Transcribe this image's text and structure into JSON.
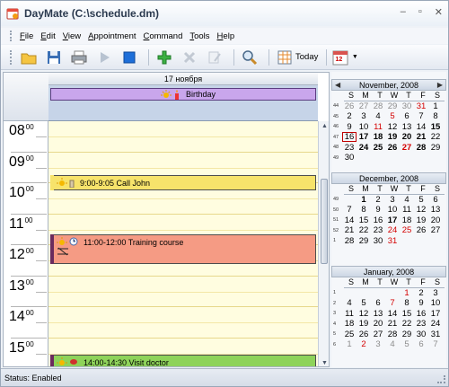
{
  "window": {
    "title": "DayMate (C:\\schedule.dm)"
  },
  "menu": {
    "items": [
      {
        "label": "File",
        "key": "F",
        "rest": "ile"
      },
      {
        "label": "Edit",
        "key": "E",
        "rest": "dit"
      },
      {
        "label": "View",
        "key": "V",
        "rest": "iew"
      },
      {
        "label": "Appointment",
        "key": "A",
        "rest": "ppointment"
      },
      {
        "label": "Command",
        "key": "C",
        "rest": "ommand"
      },
      {
        "label": "Tools",
        "key": "T",
        "rest": "ools"
      },
      {
        "label": "Help",
        "key": "H",
        "rest": "elp"
      }
    ]
  },
  "toolbar": {
    "today_label": "Today",
    "calendar_badge": "12"
  },
  "dayview": {
    "date_header": "17 ноября",
    "allday_event": "Birthday",
    "hours": [
      {
        "h": "08",
        "m": "00"
      },
      {
        "h": "09",
        "m": "00"
      },
      {
        "h": "10",
        "m": "00"
      },
      {
        "h": "11",
        "m": "00"
      },
      {
        "h": "12",
        "m": "00"
      },
      {
        "h": "13",
        "m": "00"
      },
      {
        "h": "14",
        "m": "00"
      },
      {
        "h": "15",
        "m": "00"
      }
    ],
    "appointments": [
      {
        "text": "9:00-9:05 Call John",
        "color": "#f7e36b",
        "lead": "#f7e36b"
      },
      {
        "text": "11:00-12:00 Training course",
        "color": "#f59b84",
        "lead": "#6a2b5e"
      },
      {
        "text": "14:00-14:30 Visit doctor",
        "color": "#8ed35a",
        "lead": "#6a2b5e"
      }
    ]
  },
  "calendars": {
    "dow": [
      "S",
      "M",
      "T",
      "W",
      "T",
      "F",
      "S"
    ],
    "months": [
      {
        "title": "November, 2008",
        "weeks": [
          {
            "wk": "44",
            "days": [
              [
                "26",
                "gray"
              ],
              [
                "27",
                "gray"
              ],
              [
                "28",
                "gray"
              ],
              [
                "29",
                "gray"
              ],
              [
                "30",
                "gray"
              ],
              [
                "31",
                "gray red"
              ],
              [
                "1",
                ""
              ]
            ]
          },
          {
            "wk": "45",
            "days": [
              [
                "2",
                ""
              ],
              [
                "3",
                ""
              ],
              [
                "4",
                ""
              ],
              [
                "5",
                "red"
              ],
              [
                "6",
                ""
              ],
              [
                "7",
                ""
              ],
              [
                "8",
                ""
              ]
            ]
          },
          {
            "wk": "46",
            "days": [
              [
                "9",
                ""
              ],
              [
                "10",
                ""
              ],
              [
                "11",
                "red"
              ],
              [
                "12",
                ""
              ],
              [
                "13",
                ""
              ],
              [
                "14",
                ""
              ],
              [
                "15",
                "bold"
              ]
            ]
          },
          {
            "wk": "47",
            "days": [
              [
                "16",
                "today"
              ],
              [
                "17",
                "bold"
              ],
              [
                "18",
                "bold"
              ],
              [
                "19",
                "bold"
              ],
              [
                "20",
                "bold"
              ],
              [
                "21",
                "bold"
              ],
              [
                "22",
                ""
              ]
            ]
          },
          {
            "wk": "48",
            "days": [
              [
                "23",
                ""
              ],
              [
                "24",
                "bold"
              ],
              [
                "25",
                "bold"
              ],
              [
                "26",
                "bold"
              ],
              [
                "27",
                "bold red"
              ],
              [
                "28",
                "bold"
              ],
              [
                "29",
                ""
              ]
            ]
          },
          {
            "wk": "49",
            "days": [
              [
                "30",
                ""
              ]
            ]
          }
        ]
      },
      {
        "title": "December, 2008",
        "weeks": [
          {
            "wk": "49",
            "days": [
              [
                "",
                ""
              ],
              [
                "1",
                "bold"
              ],
              [
                "2",
                ""
              ],
              [
                "3",
                ""
              ],
              [
                "4",
                ""
              ],
              [
                "5",
                ""
              ],
              [
                "6",
                ""
              ]
            ]
          },
          {
            "wk": "50",
            "days": [
              [
                "7",
                ""
              ],
              [
                "8",
                ""
              ],
              [
                "9",
                ""
              ],
              [
                "10",
                ""
              ],
              [
                "11",
                ""
              ],
              [
                "12",
                ""
              ],
              [
                "13",
                ""
              ]
            ]
          },
          {
            "wk": "51",
            "days": [
              [
                "14",
                ""
              ],
              [
                "15",
                ""
              ],
              [
                "16",
                ""
              ],
              [
                "17",
                "bold"
              ],
              [
                "18",
                ""
              ],
              [
                "19",
                ""
              ],
              [
                "20",
                ""
              ]
            ]
          },
          {
            "wk": "52",
            "days": [
              [
                "21",
                ""
              ],
              [
                "22",
                ""
              ],
              [
                "23",
                ""
              ],
              [
                "24",
                "red"
              ],
              [
                "25",
                "red"
              ],
              [
                "26",
                ""
              ],
              [
                "27",
                ""
              ]
            ]
          },
          {
            "wk": "1",
            "days": [
              [
                "28",
                ""
              ],
              [
                "29",
                ""
              ],
              [
                "30",
                ""
              ],
              [
                "31",
                "red"
              ]
            ]
          }
        ]
      },
      {
        "title": "January, 2008",
        "weeks": [
          {
            "wk": "1",
            "days": [
              [
                "",
                ""
              ],
              [
                "",
                ""
              ],
              [
                "",
                ""
              ],
              [
                "",
                ""
              ],
              [
                "1",
                "red"
              ],
              [
                "2",
                ""
              ],
              [
                "3",
                ""
              ]
            ]
          },
          {
            "wk": "2",
            "days": [
              [
                "4",
                ""
              ],
              [
                "5",
                ""
              ],
              [
                "6",
                ""
              ],
              [
                "7",
                "red"
              ],
              [
                "8",
                ""
              ],
              [
                "9",
                ""
              ],
              [
                "10",
                ""
              ]
            ]
          },
          {
            "wk": "3",
            "days": [
              [
                "11",
                ""
              ],
              [
                "12",
                ""
              ],
              [
                "13",
                ""
              ],
              [
                "14",
                ""
              ],
              [
                "15",
                ""
              ],
              [
                "16",
                ""
              ],
              [
                "17",
                ""
              ]
            ]
          },
          {
            "wk": "4",
            "days": [
              [
                "18",
                ""
              ],
              [
                "19",
                ""
              ],
              [
                "20",
                ""
              ],
              [
                "21",
                ""
              ],
              [
                "22",
                ""
              ],
              [
                "23",
                ""
              ],
              [
                "24",
                ""
              ]
            ]
          },
          {
            "wk": "5",
            "days": [
              [
                "25",
                ""
              ],
              [
                "26",
                ""
              ],
              [
                "27",
                ""
              ],
              [
                "28",
                ""
              ],
              [
                "29",
                ""
              ],
              [
                "30",
                ""
              ],
              [
                "31",
                ""
              ]
            ]
          },
          {
            "wk": "6",
            "days": [
              [
                "1",
                "gray"
              ],
              [
                "2",
                "gray red"
              ],
              [
                "3",
                "gray"
              ],
              [
                "4",
                "gray"
              ],
              [
                "5",
                "gray"
              ],
              [
                "6",
                "gray"
              ],
              [
                "7",
                "gray"
              ]
            ]
          }
        ]
      }
    ]
  },
  "status": {
    "text": "Status: Enabled"
  }
}
